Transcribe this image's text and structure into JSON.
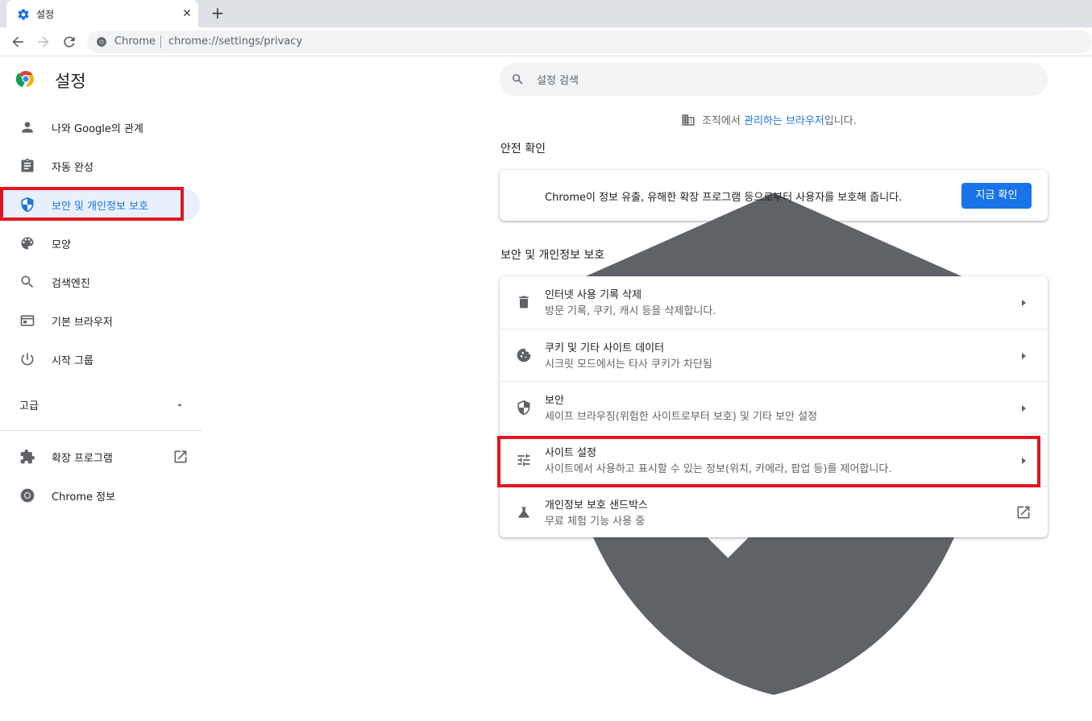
{
  "tab": {
    "title": "설정",
    "close": "✕",
    "new_tab": "+"
  },
  "omnibox": {
    "site": "Chrome",
    "url": "chrome://settings/privacy"
  },
  "sidebar": {
    "title": "설정",
    "items": [
      {
        "label": "나와 Google의 관계",
        "icon": "person-icon"
      },
      {
        "label": "자동 완성",
        "icon": "clipboard-icon"
      },
      {
        "label": "보안 및 개인정보 보호",
        "icon": "shield-icon",
        "active": true
      },
      {
        "label": "모양",
        "icon": "palette-icon"
      },
      {
        "label": "검색엔진",
        "icon": "search-icon"
      },
      {
        "label": "기본 브라우저",
        "icon": "browser-icon"
      },
      {
        "label": "시작 그룹",
        "icon": "power-icon"
      }
    ],
    "advanced": "고급",
    "extensions": "확장 프로그램",
    "about": "Chrome 정보"
  },
  "search": {
    "placeholder": "설정 검색"
  },
  "managed": {
    "prefix": "조직에서 ",
    "link": "관리하는 브라우저",
    "suffix": "입니다."
  },
  "safety_check": {
    "title": "안전 확인",
    "text": "Chrome이 정보 유출, 유해한 확장 프로그램 등으로부터 사용자를 보호해 줍니다.",
    "button": "지금 확인"
  },
  "privacy": {
    "title": "보안 및 개인정보 보호",
    "rows": [
      {
        "title": "인터넷 사용 기록 삭제",
        "subtitle": "방문 기록, 쿠키, 캐시 등을 삭제합니다.",
        "icon": "trash-icon"
      },
      {
        "title": "쿠키 및 기타 사이트 데이터",
        "subtitle": "시크릿 모드에서는 타사 쿠키가 차단됨",
        "icon": "cookie-icon"
      },
      {
        "title": "보안",
        "subtitle": "세이프 브라우징(위험한 사이트로부터 보호) 및 기타 보안 설정",
        "icon": "shield-icon"
      },
      {
        "title": "사이트 설정",
        "subtitle": "사이트에서 사용하고 표시할 수 있는 정보(위치, 카메라, 팝업 등)를 제어합니다.",
        "icon": "sliders-icon"
      },
      {
        "title": "개인정보 보호 샌드박스",
        "subtitle": "무료 체험 기능 사용 중",
        "icon": "flask-icon"
      }
    ]
  },
  "colors": {
    "accent": "#1a73e8",
    "highlight": "#e0151f",
    "active_bg": "#e8f0fe"
  }
}
